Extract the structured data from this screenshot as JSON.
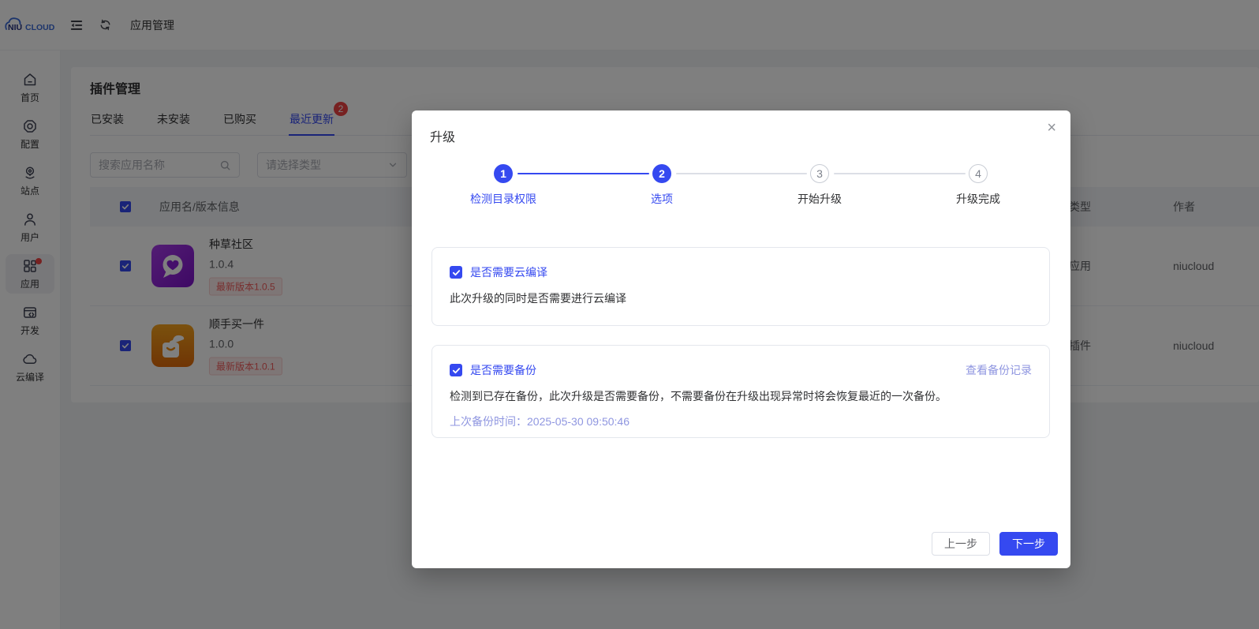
{
  "header": {
    "logo_niu": "NIU",
    "logo_cloud": "CLOUD",
    "page_title": "应用管理"
  },
  "sidebar": {
    "items": [
      {
        "label": "首页",
        "icon": "home-icon"
      },
      {
        "label": "配置",
        "icon": "settings-icon"
      },
      {
        "label": "站点",
        "icon": "site-pin-icon"
      },
      {
        "label": "用户",
        "icon": "user-icon"
      },
      {
        "label": "应用",
        "icon": "apps-grid-icon",
        "active": true,
        "has_red_dot": true
      },
      {
        "label": "开发",
        "icon": "dev-window-icon"
      },
      {
        "label": "云编译",
        "icon": "cloud-icon"
      }
    ]
  },
  "content": {
    "title": "插件管理",
    "tabs": [
      {
        "label": "已安装"
      },
      {
        "label": "未安装"
      },
      {
        "label": "已购买"
      },
      {
        "label": "最近更新",
        "badge": "2",
        "active": true
      }
    ],
    "search_placeholder": "搜索应用名称",
    "type_placeholder": "请选择类型",
    "table": {
      "col_app": "应用名/版本信息",
      "col_type": "类型",
      "col_author": "作者",
      "rows": [
        {
          "name": "种草社区",
          "version": "1.0.4",
          "latest_tag": "最新版本1.0.5",
          "type": "应用",
          "author": "niucloud",
          "icon": "heart-bubble-app-icon",
          "icon_color": "#8a1fd6"
        },
        {
          "name": "顺手买一件",
          "version": "1.0.0",
          "latest_tag": "最新版本1.0.1",
          "type": "插件",
          "author": "niucloud",
          "icon": "hand-bag-app-icon",
          "icon_color": "#ef8a10"
        }
      ]
    }
  },
  "modal": {
    "title": "升级",
    "close": "×",
    "steps": [
      {
        "num": "1",
        "label": "检测目录权限",
        "state": "done"
      },
      {
        "num": "2",
        "label": "选项",
        "state": "active"
      },
      {
        "num": "3",
        "label": "开始升级",
        "state": "pending"
      },
      {
        "num": "4",
        "label": "升级完成",
        "state": "pending"
      }
    ],
    "compile_card": {
      "label": "是否需要云编译",
      "checked": true,
      "desc": "此次升级的同时是否需要进行云编译"
    },
    "backup_card": {
      "label": "是否需要备份",
      "checked": true,
      "link": "查看备份记录",
      "desc": "检测到已存在备份，此次升级是否需要备份，不需要备份在升级出现异常时将会恢复最近的一次备份。",
      "time": "上次备份时间：2025-05-30 09:50:46"
    },
    "prev_btn": "上一步",
    "next_btn": "下一步"
  },
  "colors": {
    "primary": "#3549f0",
    "lavender": "#8f96e0",
    "red": "#ef4343",
    "tag_red": "#f15b5b"
  }
}
